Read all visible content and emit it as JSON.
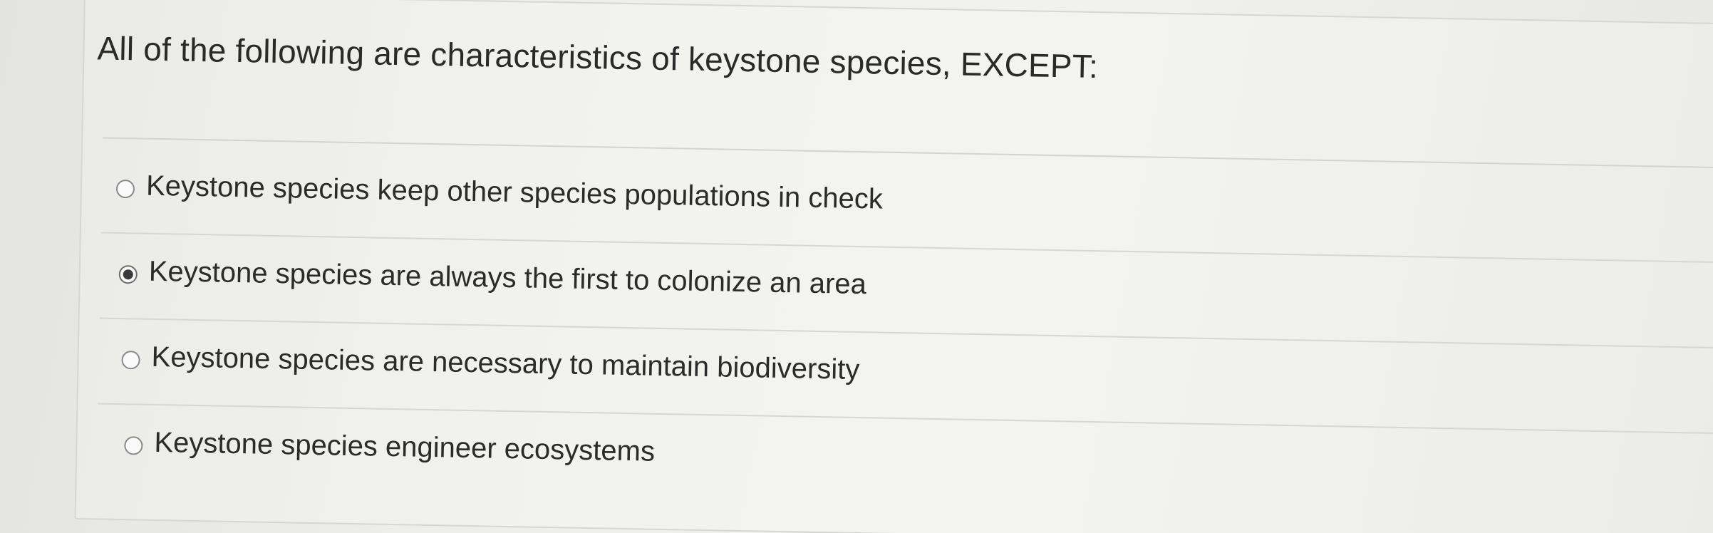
{
  "question": {
    "text": "All of the following are characteristics of keystone species, EXCEPT:"
  },
  "options": [
    {
      "label": "Keystone species keep other species populations in check",
      "selected": false
    },
    {
      "label": "Keystone species are always the first to colonize an area",
      "selected": true
    },
    {
      "label": "Keystone species are necessary to maintain biodiversity",
      "selected": false
    },
    {
      "label": "Keystone species engineer ecosystems",
      "selected": false
    }
  ]
}
